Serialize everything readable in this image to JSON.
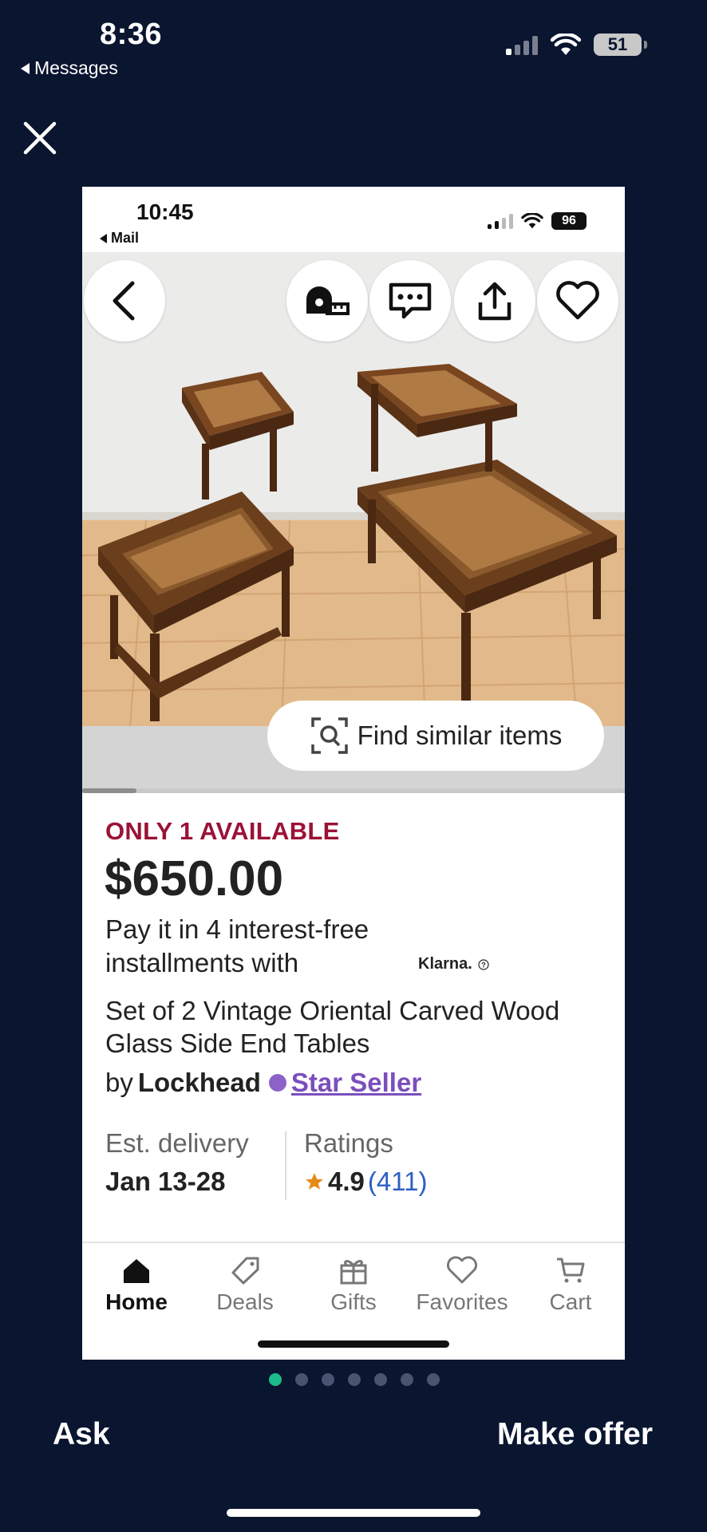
{
  "os_status": {
    "time": "8:36",
    "back_label": "Messages",
    "battery": "51"
  },
  "screenshot": {
    "status": {
      "time": "10:45",
      "back_label": "Mail",
      "battery": "96"
    },
    "find_similar_label": "Find similar items",
    "availability": "ONLY 1 AVAILABLE",
    "price": "$650.00",
    "installments": "Pay it in 4 interest-free installments with",
    "klarna_label": "Klarna.",
    "title": "Set of 2 Vintage Oriental Carved Wood Glass Side End Tables",
    "by_label": "by",
    "shop_name": "Lockhead",
    "star_seller_label": "Star Seller",
    "delivery": {
      "label": "Est. delivery",
      "value": "Jan 13-28"
    },
    "ratings": {
      "label": "Ratings",
      "score": "4.9",
      "count": "(411)"
    },
    "tabs": [
      {
        "label": "Home",
        "icon": "home-icon"
      },
      {
        "label": "Deals",
        "icon": "tag-icon"
      },
      {
        "label": "Gifts",
        "icon": "gift-icon"
      },
      {
        "label": "Favorites",
        "icon": "heart-icon"
      },
      {
        "label": "Cart",
        "icon": "cart-icon"
      }
    ]
  },
  "pager": {
    "total": 7,
    "active_index": 0
  },
  "actions": {
    "ask_label": "Ask",
    "offer_label": "Make offer"
  },
  "colors": {
    "background": "#0a1530",
    "availability": "#9b1236",
    "star_seller": "#7b4ebc",
    "ratings_count": "#2e5fc2",
    "pager_active": "#1dbb8a"
  }
}
